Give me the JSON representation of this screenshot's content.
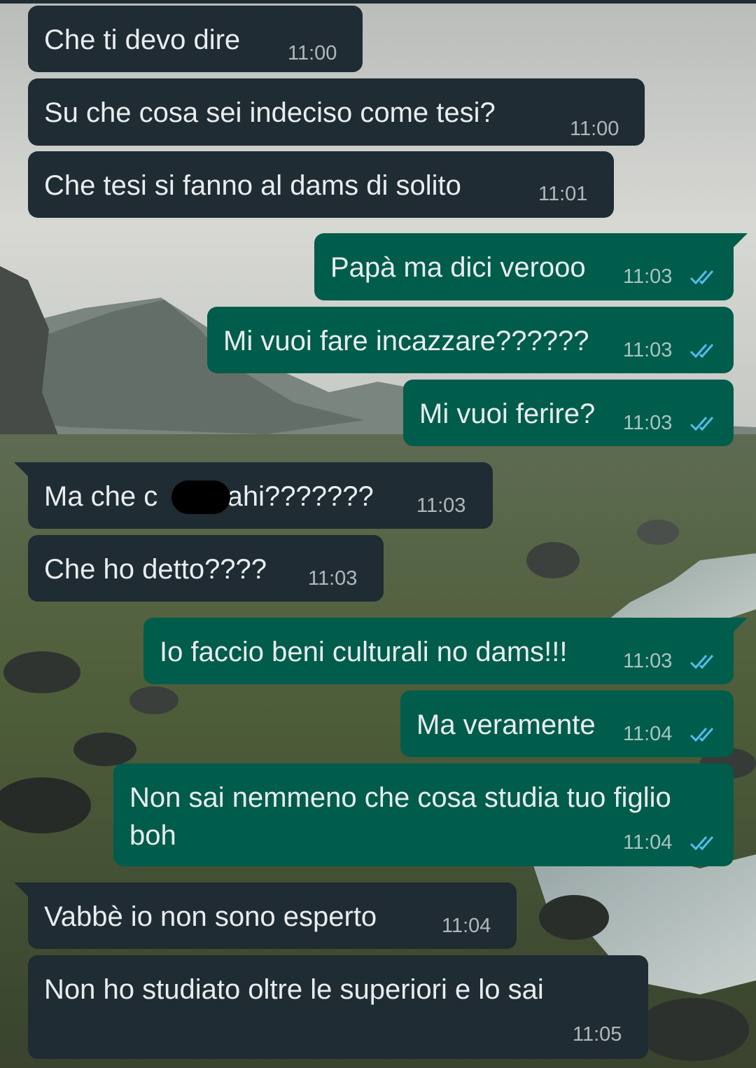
{
  "chat": {
    "messages": [
      {
        "id": "m1",
        "direction": "incoming",
        "text": "Che ti devo dire",
        "time": "11:00"
      },
      {
        "id": "m2",
        "direction": "incoming",
        "text": "Su che cosa sei indeciso come tesi?",
        "time": "11:00"
      },
      {
        "id": "m3",
        "direction": "incoming",
        "text": "Che tesi si fanno al dams di solito",
        "time": "11:01"
      },
      {
        "id": "m4",
        "direction": "outgoing",
        "text": "Papà ma dici verooo",
        "time": "11:03",
        "status": "read"
      },
      {
        "id": "m5",
        "direction": "outgoing",
        "text": "Mi vuoi fare incazzare??????",
        "time": "11:03",
        "status": "read"
      },
      {
        "id": "m6",
        "direction": "outgoing",
        "text": "Mi vuoi ferire?",
        "time": "11:03",
        "status": "read"
      },
      {
        "id": "m7",
        "direction": "incoming",
        "text_before": "Ma che c",
        "text_after": "o ahi???????",
        "time": "11:03",
        "redacted": true
      },
      {
        "id": "m8",
        "direction": "incoming",
        "text": "Che ho detto????",
        "time": "11:03"
      },
      {
        "id": "m9",
        "direction": "outgoing",
        "text": "Io faccio beni culturali no dams!!!",
        "time": "11:03",
        "status": "read"
      },
      {
        "id": "m10",
        "direction": "outgoing",
        "text": "Ma veramente",
        "time": "11:04",
        "status": "read"
      },
      {
        "id": "m11",
        "direction": "outgoing",
        "text": "Non sai nemmeno che cosa studia tuo figlio boh",
        "time": "11:04",
        "status": "read"
      },
      {
        "id": "m12",
        "direction": "incoming",
        "text": "Vabbè io non sono esperto",
        "time": "11:04"
      },
      {
        "id": "m13",
        "direction": "incoming",
        "text": "Non ho studiato oltre le superiori e lo sai",
        "time": "11:05"
      }
    ]
  },
  "colors": {
    "incoming_bubble": "#1f2c33",
    "outgoing_bubble": "#005c4b",
    "text": "#e9edef",
    "read_ticks": "#53bdeb"
  },
  "icons": {
    "read_receipt": "double-check-icon"
  }
}
